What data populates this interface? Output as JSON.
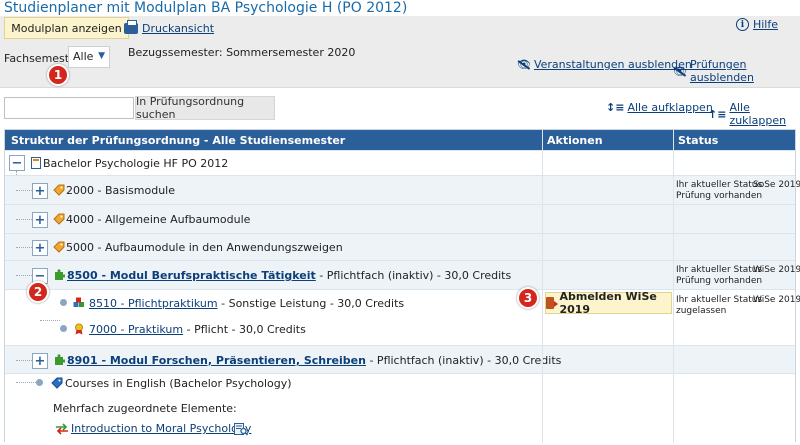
{
  "page": {
    "title": "Studienplaner mit Modulplan BA Psychologie H (PO 2012)",
    "help_label": "Hilfe"
  },
  "toolbar": {
    "modulplan_label": "Modulplan anzeigen",
    "print_label": "Druckansicht",
    "fachsemester_label": "Fachsemester",
    "fachsemester_value": "Alle",
    "bezugssemester": "Bezugssemester: Sommersemester 2020",
    "hide_veranstaltungen": "Veranstaltungen ausblenden",
    "hide_pruefungen": "Prüfungen ausblenden"
  },
  "search": {
    "value": "",
    "button_label": "In Prüfungsordnung suchen",
    "expand_all": "Alle aufklappen",
    "collapse_all": "Alle zuklappen"
  },
  "table": {
    "columns": [
      "Struktur der Prüfungsordnung - Alle Studiensemester",
      "Aktionen",
      "Status"
    ],
    "root": "Bachelor Psychologie HF PO 2012",
    "rows": [
      {
        "toggle": "+",
        "label": "2000 - Basismodule",
        "status": "Ihr aktueller Status\nPrüfung vorhanden",
        "semester": "SoSe 2019"
      },
      {
        "toggle": "+",
        "label": "4000 - Allgemeine Aufbaumodule",
        "status": "",
        "semester": ""
      },
      {
        "toggle": "+",
        "label": "5000 - Aufbaumodule in den Anwendungszweigen",
        "status": "",
        "semester": ""
      },
      {
        "toggle": "−",
        "link": "8500 - Modul Berufspraktische Tätigkeit",
        "suffix": " - Pflichtfach (inaktiv) - 30,0 Credits",
        "status": "Ihr aktueller Status\nPrüfung vorhanden",
        "semester": "WiSe 2019"
      },
      {
        "link": "8510 - Pflichtpraktikum",
        "suffix": " - Sonstige Leistung - 30,0 Credits",
        "action": "Abmelden WiSe 2019",
        "status": "Ihr aktueller Status\nzugelassen",
        "semester": "WiSe 2019"
      },
      {
        "link": "7000 - Praktikum",
        "suffix": " - Pflicht - 30,0 Credits"
      },
      {
        "toggle": "+",
        "link": "8901 - Modul Forschen, Präsentieren, Schreiben",
        "suffix": " - Pflichtfach (inaktiv) - 30,0 Credits"
      },
      {
        "label": "Courses in English (Bachelor Psychology)"
      }
    ],
    "mehrfach_label": "Mehrfach zugeordnete Elemente:",
    "mehrfach_link": "Introduction to Moral Psychology"
  },
  "badges": [
    "1",
    "2",
    "3"
  ],
  "colors": {
    "header_bg": "#2a5f9a",
    "button_yellow": "#fbf4cc",
    "badge_red": "#d3261d",
    "link": "#0b3f7a"
  }
}
